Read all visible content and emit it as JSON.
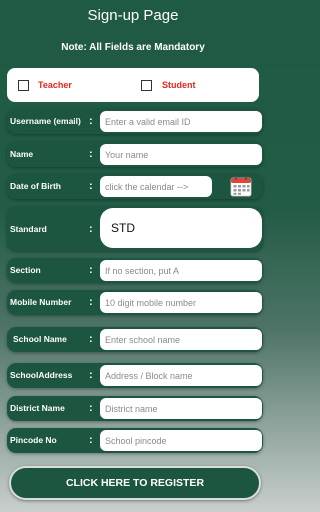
{
  "header": {
    "title": "Sign-up Page",
    "note": "Note:  All Fields are Mandatory"
  },
  "roles": {
    "teacher": "Teacher",
    "student": "Student"
  },
  "form": {
    "colon": ":",
    "username": {
      "label": "Username (email)",
      "placeholder": "Enter a valid email ID"
    },
    "name": {
      "label": "Name",
      "placeholder": "Your name"
    },
    "dob": {
      "label": "Date of Birth",
      "placeholder": "click the calendar -->"
    },
    "standard": {
      "label": "Standard",
      "value": "STD"
    },
    "section": {
      "label": "Section",
      "placeholder": "If no section, put A"
    },
    "mobile": {
      "label": "Mobile Number",
      "placeholder": "10 digit mobile number"
    },
    "school_name": {
      "label": "School Name",
      "placeholder": "Enter school name"
    },
    "school_address": {
      "label": "SchoolAddress",
      "placeholder": "Address / Block name"
    },
    "district": {
      "label": "District Name",
      "placeholder": "District name"
    },
    "pincode": {
      "label": "Pincode No",
      "placeholder": "School pincode"
    }
  },
  "register_label": "CLICK HERE TO REGISTER",
  "colors": {
    "primary_green": "#1d5640",
    "role_red": "#e5261f"
  }
}
